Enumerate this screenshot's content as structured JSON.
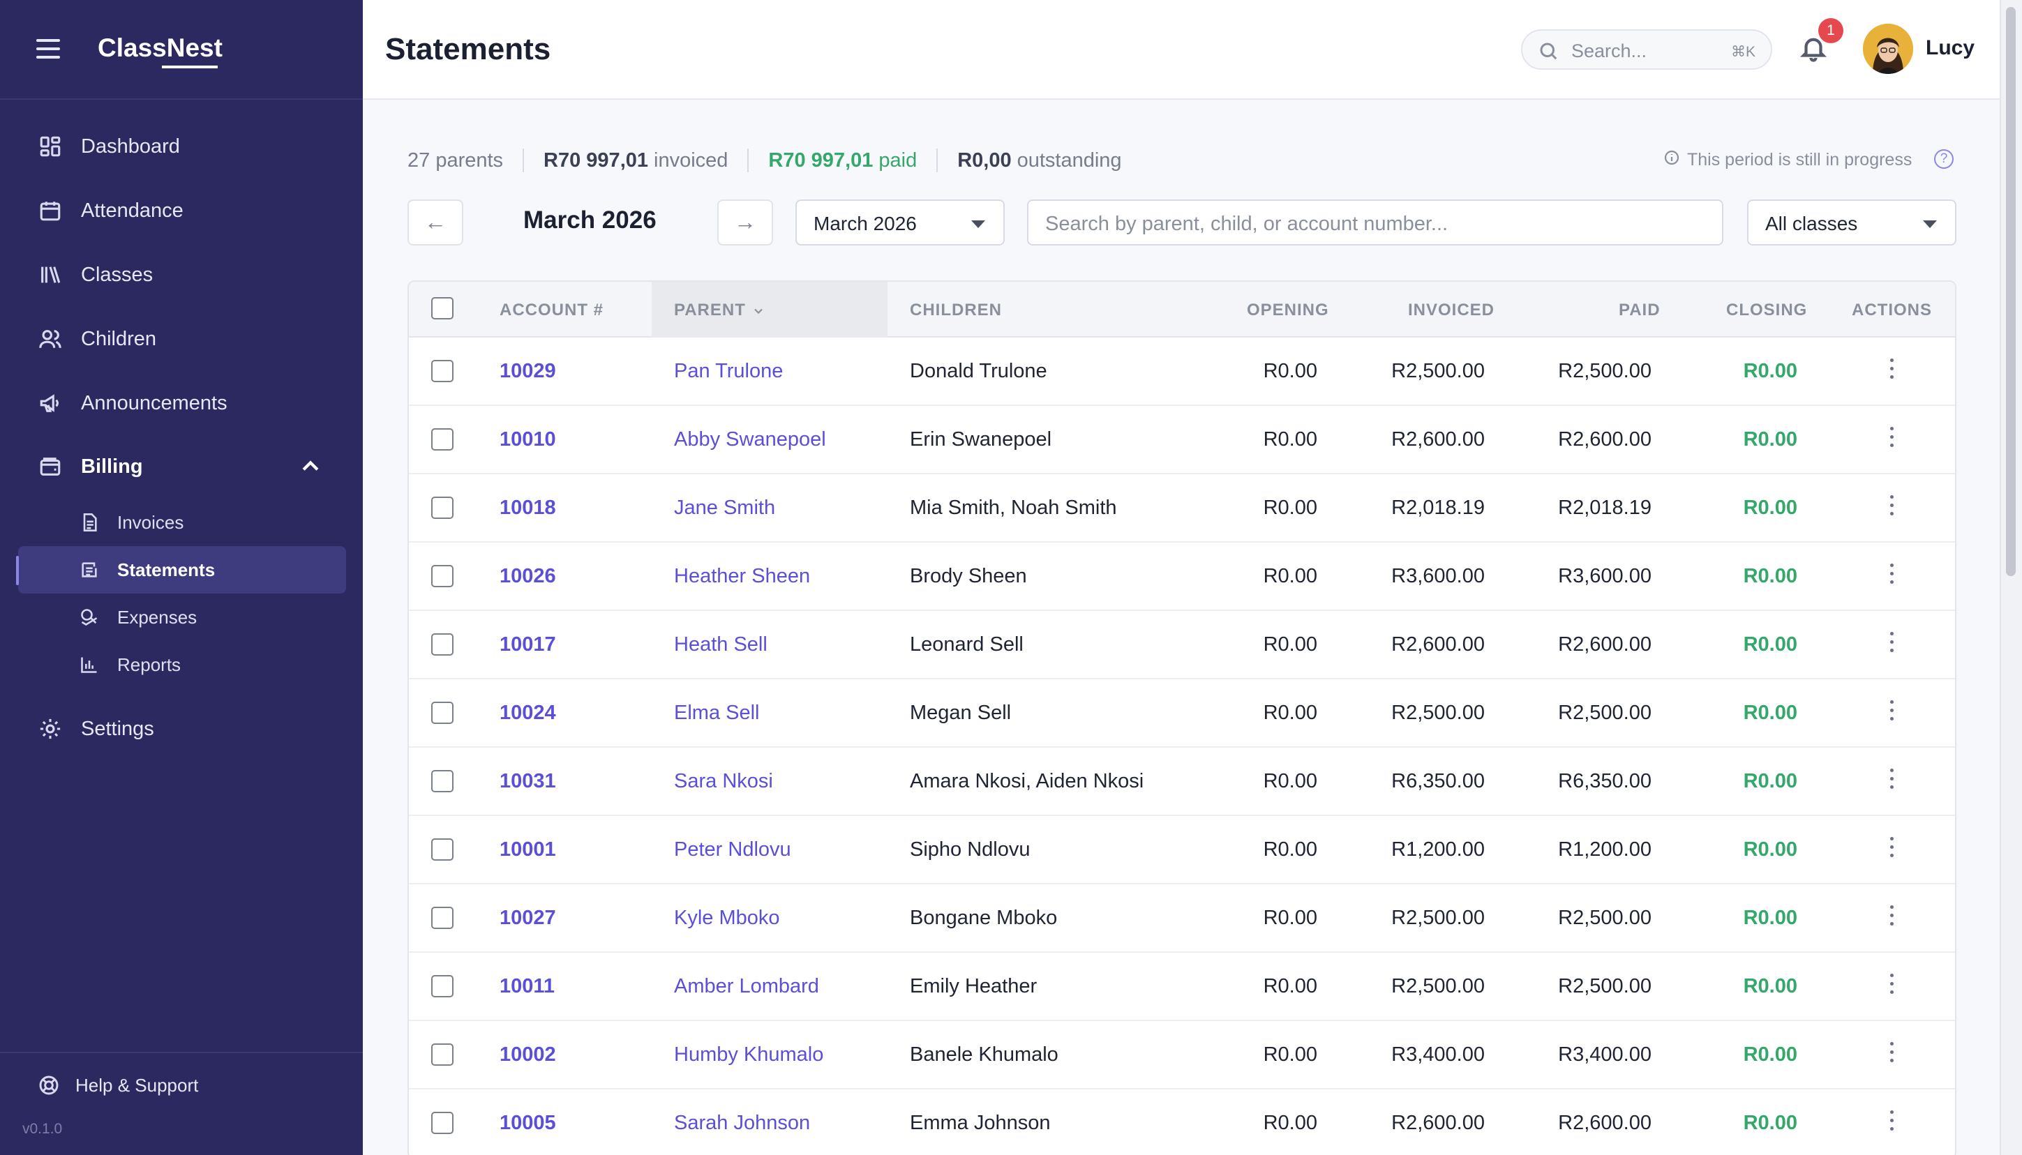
{
  "app": {
    "name": "ClassNest",
    "version": "v0.1.0"
  },
  "sidebar": {
    "items": [
      {
        "label": "Dashboard",
        "icon": "dashboard-icon"
      },
      {
        "label": "Attendance",
        "icon": "calendar-icon"
      },
      {
        "label": "Classes",
        "icon": "books-icon"
      },
      {
        "label": "Children",
        "icon": "users-icon"
      },
      {
        "label": "Announcements",
        "icon": "megaphone-icon"
      },
      {
        "label": "Billing",
        "icon": "wallet-icon",
        "expanded": true
      },
      {
        "label": "Settings",
        "icon": "gear-icon"
      }
    ],
    "billing_sub": [
      {
        "label": "Invoices",
        "icon": "file-icon"
      },
      {
        "label": "Statements",
        "icon": "statement-icon",
        "active": true
      },
      {
        "label": "Expenses",
        "icon": "coins-icon"
      },
      {
        "label": "Reports",
        "icon": "bar-chart-icon"
      }
    ],
    "help_label": "Help & Support"
  },
  "header": {
    "title": "Statements",
    "search_placeholder": "Search...",
    "search_shortcut": "⌘K",
    "notification_count": "1",
    "user_name": "Lucy"
  },
  "summary": {
    "parents_count": "27 parents",
    "invoiced_amount": "R70 997,01",
    "invoiced_label": "invoiced",
    "paid_amount": "R70 997,01",
    "paid_label": "paid",
    "outstanding_amount": "R0,00",
    "outstanding_label": "outstanding",
    "period_note": "This period is still in progress"
  },
  "toolbar": {
    "prev": "←",
    "next": "→",
    "period_label": "March 2026",
    "period_select": "March 2026",
    "search_placeholder": "Search by parent, child, or account number...",
    "class_filter": "All classes"
  },
  "table": {
    "columns": [
      "ACCOUNT #",
      "PARENT",
      "CHILDREN",
      "OPENING",
      "INVOICED",
      "PAID",
      "CLOSING",
      "ACTIONS"
    ],
    "sorted_by": "PARENT",
    "rows": [
      {
        "account": "10029",
        "parent": "Pan Trulone",
        "children": "Donald Trulone",
        "opening": "R0.00",
        "invoiced": "R2,500.00",
        "paid": "R2,500.00",
        "closing": "R0.00"
      },
      {
        "account": "10010",
        "parent": "Abby Swanepoel",
        "children": "Erin Swanepoel",
        "opening": "R0.00",
        "invoiced": "R2,600.00",
        "paid": "R2,600.00",
        "closing": "R0.00"
      },
      {
        "account": "10018",
        "parent": "Jane Smith",
        "children": "Mia Smith, Noah Smith",
        "opening": "R0.00",
        "invoiced": "R2,018.19",
        "paid": "R2,018.19",
        "closing": "R0.00"
      },
      {
        "account": "10026",
        "parent": "Heather Sheen",
        "children": "Brody Sheen",
        "opening": "R0.00",
        "invoiced": "R3,600.00",
        "paid": "R3,600.00",
        "closing": "R0.00"
      },
      {
        "account": "10017",
        "parent": "Heath Sell",
        "children": "Leonard Sell",
        "opening": "R0.00",
        "invoiced": "R2,600.00",
        "paid": "R2,600.00",
        "closing": "R0.00"
      },
      {
        "account": "10024",
        "parent": "Elma Sell",
        "children": "Megan Sell",
        "opening": "R0.00",
        "invoiced": "R2,500.00",
        "paid": "R2,500.00",
        "closing": "R0.00"
      },
      {
        "account": "10031",
        "parent": "Sara Nkosi",
        "children": "Amara Nkosi, Aiden Nkosi",
        "opening": "R0.00",
        "invoiced": "R6,350.00",
        "paid": "R6,350.00",
        "closing": "R0.00"
      },
      {
        "account": "10001",
        "parent": "Peter Ndlovu",
        "children": "Sipho Ndlovu",
        "opening": "R0.00",
        "invoiced": "R1,200.00",
        "paid": "R1,200.00",
        "closing": "R0.00"
      },
      {
        "account": "10027",
        "parent": "Kyle Mboko",
        "children": "Bongane Mboko",
        "opening": "R0.00",
        "invoiced": "R2,500.00",
        "paid": "R2,500.00",
        "closing": "R0.00"
      },
      {
        "account": "10011",
        "parent": "Amber Lombard",
        "children": "Emily Heather",
        "opening": "R0.00",
        "invoiced": "R2,500.00",
        "paid": "R2,500.00",
        "closing": "R0.00"
      },
      {
        "account": "10002",
        "parent": "Humby Khumalo",
        "children": "Banele Khumalo",
        "opening": "R0.00",
        "invoiced": "R3,400.00",
        "paid": "R3,400.00",
        "closing": "R0.00"
      },
      {
        "account": "10005",
        "parent": "Sarah Johnson",
        "children": "Emma Johnson",
        "opening": "R0.00",
        "invoiced": "R2,600.00",
        "paid": "R2,600.00",
        "closing": "R0.00"
      }
    ]
  },
  "colors": {
    "sidebar": "#2b2960",
    "accent": "#5a4fd8",
    "success": "#34a86a",
    "badge": "#e5484d"
  }
}
